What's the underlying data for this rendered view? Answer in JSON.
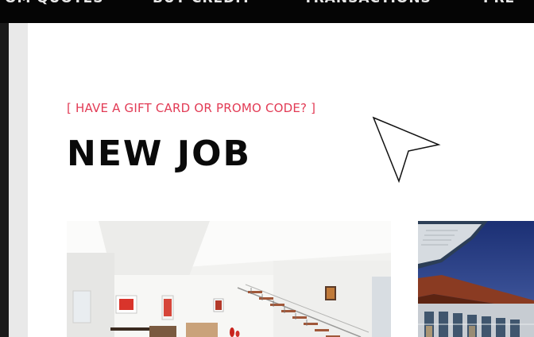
{
  "nav": {
    "items": [
      {
        "label": "OM QUOTES"
      },
      {
        "label": "BUY CREDIT"
      },
      {
        "label": "TRANSACTIONS"
      },
      {
        "label": "PRE"
      }
    ]
  },
  "promo": {
    "label": "[ HAVE A GIFT CARD OR PROMO CODE? ]"
  },
  "page": {
    "title": "NEW JOB"
  },
  "cards": [
    {
      "icon": "interior-staircase-photo"
    },
    {
      "icon": "house-exterior-photo"
    }
  ],
  "colors": {
    "nav_bg": "#050505",
    "promo": "#e23b55",
    "title": "#0a0a0a",
    "gutter": "#e9e9e9"
  },
  "cursor": {
    "icon": "arrow-cursor-icon"
  }
}
